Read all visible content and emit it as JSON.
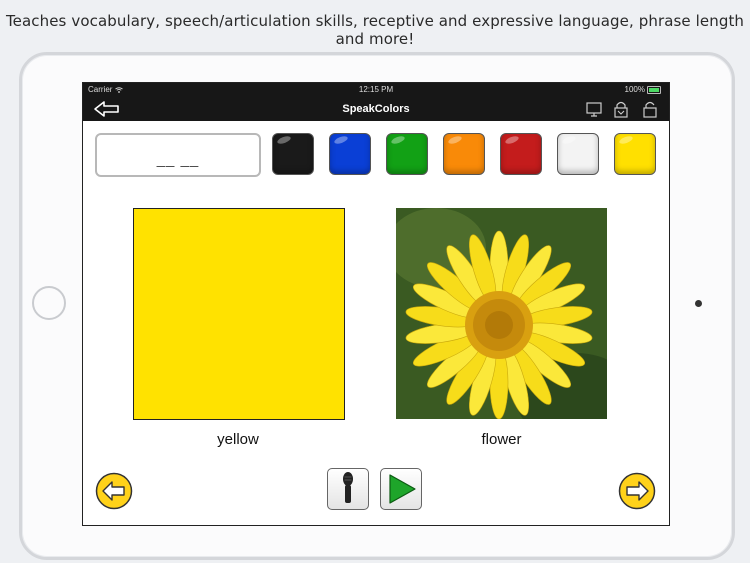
{
  "caption": "Teaches vocabulary, speech/articulation skills, receptive and expressive language, phrase length and more!",
  "status_bar": {
    "carrier": "Carrier",
    "time": "12:15 PM",
    "battery": "100%"
  },
  "nav_bar": {
    "title": "SpeakColors"
  },
  "answer_box": {
    "blanks": "__ __"
  },
  "swatches": [
    {
      "name": "black",
      "color": "#1a1a1a"
    },
    {
      "name": "blue",
      "color": "#0a3fd6"
    },
    {
      "name": "green",
      "color": "#12a115"
    },
    {
      "name": "orange",
      "color": "#f98a08"
    },
    {
      "name": "red",
      "color": "#c41c1c"
    },
    {
      "name": "white",
      "color": "#f3f3f3"
    },
    {
      "name": "yellow",
      "color": "#ffe000"
    }
  ],
  "color_card": {
    "color": "#ffe200",
    "label": "yellow"
  },
  "picture_card": {
    "label": "flower"
  },
  "icons": {
    "back": "back-arrow-icon",
    "display": "monitor-icon",
    "lock_menu": "lock-menu-icon",
    "unlock": "unlock-icon",
    "prev": "left-arrow-icon",
    "next": "right-arrow-icon",
    "record": "microphone-icon",
    "play": "play-icon"
  }
}
